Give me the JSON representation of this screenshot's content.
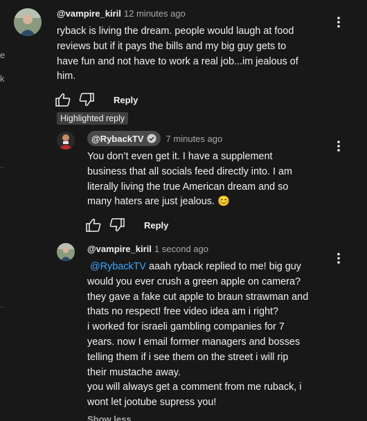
{
  "comments": [
    {
      "handle": "@vampire_kiril",
      "time": "12 minutes ago",
      "lines": [
        "ryback is living the dream. people would laugh at food",
        "reviews but if it pays the bills and my big guy gets to",
        "have fun and not have to work a real job...im jealous of",
        "him."
      ],
      "reply_label": "Reply"
    }
  ],
  "highlight_badge": "Highlighted reply",
  "replies": [
    {
      "handle": "@RybackTV",
      "time": "7 minutes ago",
      "verified": true,
      "lines": [
        "You don’t even get it. I have a supplement",
        "business that all socials feed directly into. I am",
        "literally living the true American dream and so",
        "many haters are just jealous. 😊"
      ],
      "reply_label": "Reply"
    },
    {
      "handle": "@vampire_kiril",
      "time": "1 second ago",
      "mention": "@RybackTV",
      "first_line_rest": " aaah ryback replied to me! big guy",
      "lines": [
        "would you ever crush a green apple on camera?",
        "they gave a fake cut apple to braun strawman and",
        "thats no respect! free video idea am i right?",
        "i worked for israeli gambling companies for 7",
        "years. now I email former managers and bosses",
        "telling them if i see them on the street i will rip",
        "their mustache away.",
        "you will always get a comment from me ruback, i",
        "wont let jootube supress you!"
      ]
    }
  ],
  "show_less": "Show less",
  "icons": {
    "like": "thumbs-up-icon",
    "dislike": "thumbs-down-icon",
    "more": "more-vert-icon",
    "verified": "verified-check-icon"
  },
  "colors": {
    "background": "#181818",
    "mention": "#3ea6ff",
    "badge": "#3f3f3f",
    "muted": "#aaaaaa"
  }
}
